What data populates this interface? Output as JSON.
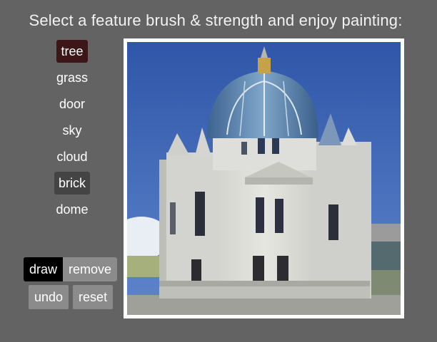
{
  "header": {
    "instruction": "Select a feature brush & strength and enjoy painting:"
  },
  "features": [
    {
      "label": "tree",
      "selected": true
    },
    {
      "label": "grass",
      "selected": false
    },
    {
      "label": "door",
      "selected": false
    },
    {
      "label": "sky",
      "selected": false
    },
    {
      "label": "cloud",
      "selected": false
    },
    {
      "label": "brick",
      "selected": true
    },
    {
      "label": "dome",
      "selected": false
    }
  ],
  "modes": {
    "draw_label": "draw",
    "remove_label": "remove",
    "active": "draw"
  },
  "actions": {
    "undo_label": "undo",
    "reset_label": "reset"
  },
  "colors": {
    "background": "#636363",
    "tree_selected": "#3d1717",
    "brick_selected": "#444444",
    "draw_active": "#000000",
    "button_grey": "#8b8b8b",
    "sky": "#3a62b8",
    "dome": "#5a82b0",
    "stone": "#d9d9d6"
  }
}
